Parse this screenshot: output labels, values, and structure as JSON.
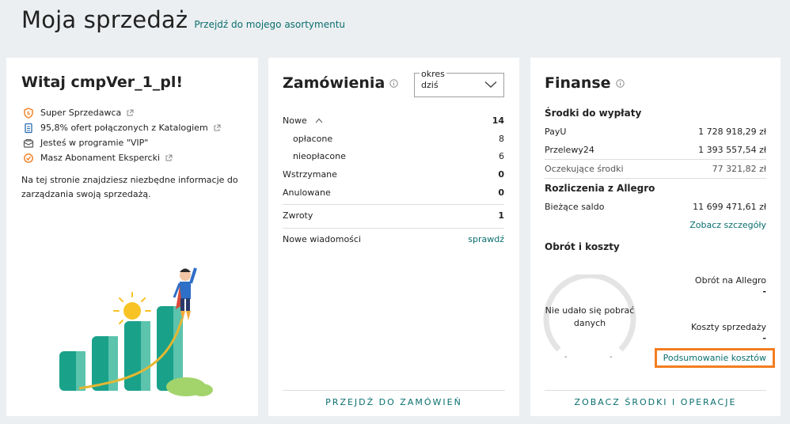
{
  "header": {
    "title": "Moja sprzedaż",
    "link": "Przejdź do mojego asortymentu"
  },
  "welcome": {
    "title": "Witaj cmpVer_1_pl!",
    "badges": [
      {
        "label": "Super Sprzedawca",
        "icon": "super-seller-icon"
      },
      {
        "label": "95,8% ofert połączonych z Katalogiem",
        "icon": "catalog-icon"
      },
      {
        "label": "Jesteś w programie \"VIP\"",
        "icon": "vip-icon"
      },
      {
        "label": "Masz Abonament Ekspercki",
        "icon": "subscription-icon"
      }
    ],
    "description": "Na tej stronie znajdziesz niezbędne informacje do zarządzania swoją sprzedażą."
  },
  "orders": {
    "title": "Zamówienia",
    "period_label": "okres",
    "period_value": "dziś",
    "rows": {
      "new": {
        "label": "Nowe",
        "value": "14"
      },
      "paid": {
        "label": "opłacone",
        "value": "8"
      },
      "unpaid": {
        "label": "nieopłacone",
        "value": "6"
      },
      "held": {
        "label": "Wstrzymane",
        "value": "0"
      },
      "cancelled": {
        "label": "Anulowane",
        "value": "0"
      },
      "returns": {
        "label": "Zwroty",
        "value": "1"
      },
      "messages": {
        "label": "Nowe wiadomości",
        "link": "sprawdź"
      }
    },
    "bottom_action": "PRZEJDŹ DO ZAMÓWIEŃ"
  },
  "finance": {
    "title": "Finanse",
    "payout_heading": "Środki do wypłaty",
    "payu": {
      "label": "PayU",
      "value": "1 728 918,29 zł"
    },
    "przelewy": {
      "label": "Przelewy24",
      "value": "1 393 557,54 zł"
    },
    "pending": {
      "label": "Oczekujące środki",
      "value": "77 321,82 zł"
    },
    "allegro_heading": "Rozliczenia z Allegro",
    "balance": {
      "label": "Bieżące saldo",
      "value": "11 699 471,61 zł"
    },
    "details_link": "Zobacz szczegóły",
    "turnover_heading": "Obrót i koszty",
    "gauge_message": "Nie udało się pobrać danych",
    "gauge_left": "-",
    "gauge_right": "-",
    "turnover_label": "Obrót na Allegro",
    "turnover_value": "-",
    "costs_label": "Koszty sprzedaży",
    "costs_value": "-",
    "costs_summary_link": "Podsumowanie kosztów",
    "bottom_action": "ZOBACZ ŚRODKI I OPERACJE"
  },
  "colors": {
    "accent": "#0a6e6e",
    "highlight": "#f37e20",
    "background": "#eceff1"
  }
}
